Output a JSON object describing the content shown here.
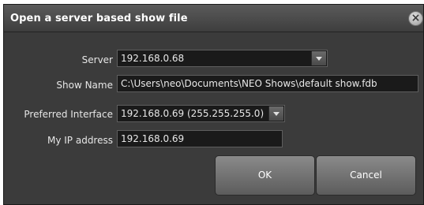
{
  "dialog": {
    "title": "Open a server based show file",
    "close_icon": "close-icon"
  },
  "form": {
    "server_label": "Server",
    "server_value": "192.168.0.68",
    "show_name_label": "Show Name",
    "show_name_value": "C:\\Users\\neo\\Documents\\NEO Shows\\default show.fdb",
    "interface_label": "Preferred Interface",
    "interface_value": "192.168.0.69 (255.255.255.0)",
    "ip_label": "My IP address",
    "ip_value": "192.168.0.69"
  },
  "buttons": {
    "ok": "OK",
    "cancel": "Cancel"
  }
}
